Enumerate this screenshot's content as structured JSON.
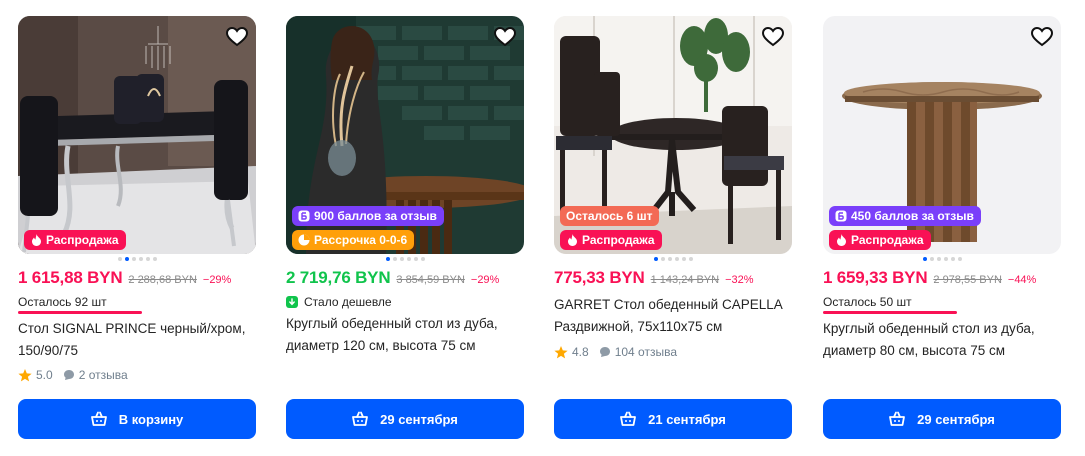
{
  "colors": {
    "accent": "#005bff",
    "sale_red": "#f91155",
    "price_green": "#10c44c",
    "points_purple": "#7a3ffa",
    "installment_orange": "#ff9f0a",
    "stock_salmon": "#f36a55"
  },
  "products": [
    {
      "price": "1 615,88 BYN",
      "old_price": "2 288,68 BYN",
      "discount": "−29%",
      "stock": "Осталось 92 шт",
      "stock_level": 0.52,
      "title": "Стол SIGNAL PRINCE черный/хром, 150/90/75",
      "rating": "5.0",
      "reviews": "2 отзыва",
      "badges": [
        {
          "label": "Распродажа",
          "icon": "flame-icon",
          "color": "#f91155"
        }
      ],
      "button": "В корзину",
      "button_icon": "cart-icon",
      "favorite_icon": "heart-icon",
      "gallery": {
        "count": 6,
        "active": 1
      }
    },
    {
      "price": "2 719,76 BYN",
      "old_price": "3 854,59 BYN",
      "discount": "−29%",
      "cheaper_label": "Стало дешевле",
      "cheaper_icon": "price-down-icon",
      "title": "Круглый обеденный стол из дуба, диаметр 120 см, высота 75 см",
      "badges": [
        {
          "label": "900 баллов за отзыв",
          "icon": "points-icon",
          "color": "#7a3ffa"
        },
        {
          "label": "Рассрочка 0-0-6",
          "icon": "installment-icon",
          "color": "#ff9f0a"
        }
      ],
      "button": "29 сентября",
      "button_icon": "cart-icon",
      "favorite_icon": "heart-icon",
      "gallery": {
        "count": 6,
        "active": 0
      }
    },
    {
      "price": "775,33 BYN",
      "old_price": "1 143,24 BYN",
      "discount": "−32%",
      "title": "GARRET Стол обеденный CAPELLA Раздвижной, 75х110х75 см",
      "rating": "4.8",
      "reviews": "104 отзыва",
      "badges": [
        {
          "label": "Осталось 6 шт",
          "icon": "",
          "color": "#f36a55"
        },
        {
          "label": "Распродажа",
          "icon": "flame-icon",
          "color": "#f91155"
        }
      ],
      "button": "21 сентября",
      "button_icon": "cart-icon",
      "favorite_icon": "heart-icon",
      "gallery": {
        "count": 6,
        "active": 0
      }
    },
    {
      "price": "1 659,33 BYN",
      "old_price": "2 978,55 BYN",
      "discount": "−44%",
      "stock": "Осталось 50 шт",
      "stock_level": 0.56,
      "title": "Круглый обеденный стол из дуба, диаметр 80 см, высота 75 см",
      "badges": [
        {
          "label": "450 баллов за отзыв",
          "icon": "points-icon",
          "color": "#7a3ffa"
        },
        {
          "label": "Распродажа",
          "icon": "flame-icon",
          "color": "#f91155"
        }
      ],
      "button": "29 сентября",
      "button_icon": "cart-icon",
      "favorite_icon": "heart-icon",
      "gallery": {
        "count": 6,
        "active": 0
      }
    }
  ]
}
